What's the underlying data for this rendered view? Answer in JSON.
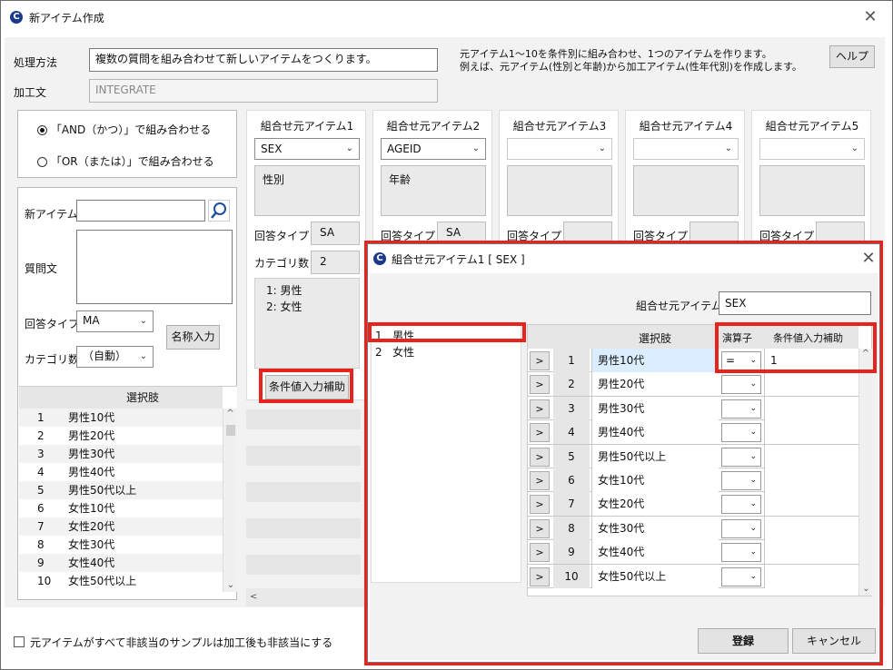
{
  "window": {
    "title": "新アイテム作成",
    "close": "✕",
    "app_icon": "C"
  },
  "top": {
    "method_label": "処理方法",
    "method_value": "複数の質問を組み合わせて新しいアイテムをつくります。",
    "formula_label": "加工文",
    "formula_value": "INTEGRATE",
    "desc_line1": "元アイテム1～10を条件別に組み合わせ、1つのアイテムを作ります。",
    "desc_line2": "例えば、元アイテム(性別と年齢)から加工アイテム(性年代別)を作成します。",
    "help_button": "ヘルプ"
  },
  "combine": {
    "and_label": "「AND（かつ）」で組み合わせる",
    "or_label": "「OR（または）」で組み合わせる",
    "selected": "and"
  },
  "new_item": {
    "name_label": "新アイテム",
    "question_label": "質問文",
    "answer_type_label": "回答タイプ",
    "answer_type_value": "MA",
    "category_count_label": "カテゴリ数",
    "category_count_value": "（自動）",
    "name_input_button": "名称入力",
    "choices_header": "選択肢",
    "choices": [
      {
        "no": "1",
        "label": "男性10代"
      },
      {
        "no": "2",
        "label": "男性20代"
      },
      {
        "no": "3",
        "label": "男性30代"
      },
      {
        "no": "4",
        "label": "男性40代"
      },
      {
        "no": "5",
        "label": "男性50代以上"
      },
      {
        "no": "6",
        "label": "女性10代"
      },
      {
        "no": "7",
        "label": "女性20代"
      },
      {
        "no": "8",
        "label": "女性30代"
      },
      {
        "no": "9",
        "label": "女性40代"
      },
      {
        "no": "10",
        "label": "女性50代以上"
      }
    ]
  },
  "source_items": {
    "answer_type_label": "回答タイプ",
    "category_count_label": "カテゴリ数",
    "assist_button": "条件値入力補助",
    "columns": [
      {
        "header": "組合せ元アイテム1",
        "value": "SEX",
        "description": "性別",
        "answer_type": "SA",
        "category_count": "2",
        "categories": [
          "1: 男性",
          "2: 女性"
        ]
      },
      {
        "header": "組合せ元アイテム2",
        "value": "AGEID",
        "description": "年齢",
        "answer_type": "SA"
      },
      {
        "header": "組合せ元アイテム3",
        "value": "",
        "description": "",
        "answer_type": ""
      },
      {
        "header": "組合せ元アイテム4",
        "value": "",
        "description": "",
        "answer_type": ""
      },
      {
        "header": "組合せ元アイテム5",
        "value": "",
        "description": "",
        "answer_type": ""
      }
    ]
  },
  "footer": {
    "checkbox_label": "元アイテムがすべて非該当のサンプルは加工後も非該当にする"
  },
  "dialog": {
    "title": "組合せ元アイテム1 [ SEX ]",
    "close": "✕",
    "item_label": "組合せ元アイテム1",
    "item_value": "SEX",
    "list": [
      {
        "no": "1",
        "label": "男性"
      },
      {
        "no": "2",
        "label": "女性"
      }
    ],
    "grid_headers": {
      "choice": "選択肢",
      "operator": "演算子",
      "condition": "条件値入力補助"
    },
    "rows": [
      {
        "btn": ">",
        "no": "1",
        "label": "男性10代",
        "op": "=",
        "val": "1"
      },
      {
        "btn": ">",
        "no": "2",
        "label": "男性20代",
        "op": "",
        "val": ""
      },
      {
        "btn": ">",
        "no": "3",
        "label": "男性30代",
        "op": "",
        "val": ""
      },
      {
        "btn": ">",
        "no": "4",
        "label": "男性40代",
        "op": "",
        "val": ""
      },
      {
        "btn": ">",
        "no": "5",
        "label": "男性50代以上",
        "op": "",
        "val": ""
      },
      {
        "btn": ">",
        "no": "6",
        "label": "女性10代",
        "op": "",
        "val": ""
      },
      {
        "btn": ">",
        "no": "7",
        "label": "女性20代",
        "op": "",
        "val": ""
      },
      {
        "btn": ">",
        "no": "8",
        "label": "女性30代",
        "op": "",
        "val": ""
      },
      {
        "btn": ">",
        "no": "9",
        "label": "女性40代",
        "op": "",
        "val": ""
      },
      {
        "btn": ">",
        "no": "10",
        "label": "女性50代以上",
        "op": "",
        "val": ""
      }
    ],
    "register_button": "登録",
    "cancel_button": "キャンセル"
  },
  "colors": {
    "highlight": "#e8231c",
    "selected_row": "#dbeeff",
    "app_icon": "#1b3a8c"
  }
}
